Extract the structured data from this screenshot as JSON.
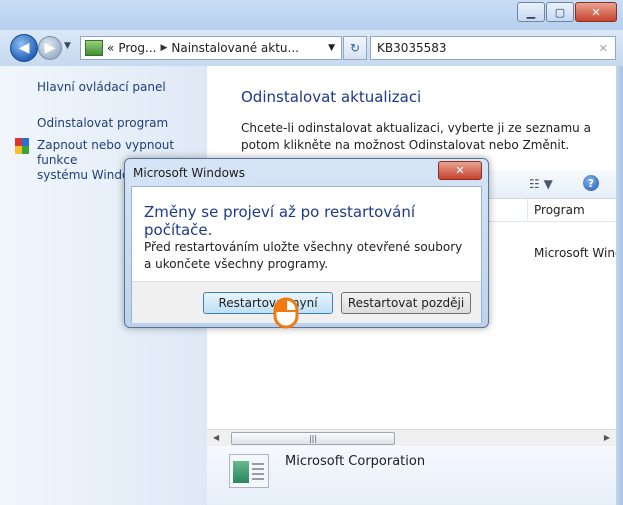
{
  "window": {
    "buttons": {
      "minimize": "▁",
      "maximize": "▢",
      "close": "✕"
    }
  },
  "navigation": {
    "back_glyph": "◀",
    "forward_glyph": "▶",
    "address": {
      "prefix": "«",
      "crumb1": "Prog...",
      "crumb2": "Nainstalované aktu...",
      "separator": "▶",
      "dropdown": "▼"
    },
    "refresh_glyph": "↻",
    "search": {
      "value": "KB3035583",
      "clear_glyph": "✕"
    }
  },
  "left_pane": {
    "link_control_panel": "Hlavní ovládací panel",
    "link_uninstall_program": "Odinstalovat program",
    "link_features_line1": "Zapnout nebo vypnout funkce",
    "link_features_line2": "systému Windows"
  },
  "main": {
    "title": "Odinstalovat aktualizaci",
    "description": "Chcete-li odinstalovat aktualizaci, vyberte ji ze seznamu a potom klikněte na možnost Odinstalovat nebo Změnit.",
    "toolbar": {
      "views_glyph": "☷ ▼",
      "help_glyph": "?"
    },
    "columns": {
      "program": "Program"
    },
    "row": {
      "paren": ")",
      "program": "Microsoft Windo"
    },
    "scrollbar": {
      "left": "◀",
      "right": "▶",
      "grip": "|||"
    },
    "details": {
      "publisher": "Microsoft Corporation"
    }
  },
  "dialog": {
    "title": "Microsoft Windows",
    "close_glyph": "✕",
    "heading": "Změny se projeví až po restartování počítače.",
    "message": "Před restartováním uložte všechny otevřené soubory a ukončete všechny programy.",
    "button_now": "Restartovat nyní",
    "button_later": "Restartovat později"
  },
  "colors": {
    "accent_heading": "#1c3a8a",
    "link": "#1e3f78",
    "cursor": "#f07a10"
  }
}
